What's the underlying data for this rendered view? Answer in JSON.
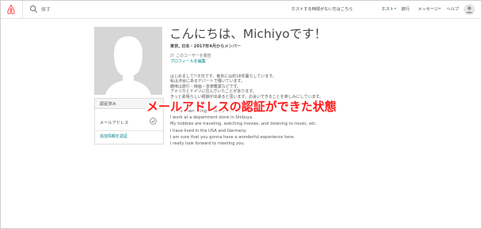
{
  "colors": {
    "brand": "#ff5a5f",
    "link": "#008489",
    "dot": "#00a699",
    "overlay": "#ff1a1a"
  },
  "header": {
    "logo_icon": "airbnb-logo-icon",
    "search_icon": "search-icon",
    "search_placeholder": "探す",
    "nav": {
      "host_label": "ホストする時間がない方はこちら",
      "host_short": "ホスト",
      "trips": "旅行",
      "messages": "メッセージ",
      "help": "ヘルプ",
      "avatar_icon": "user-avatar-icon"
    }
  },
  "sidebar": {
    "photo_icon": "profile-silhouette-icon",
    "verified_title": "認証済み",
    "email_label": "メールアドレス",
    "check_icon": "check-circle-icon",
    "add_verification": "追加情報を認証"
  },
  "main": {
    "greeting": "こんにちは、Michiyoです！",
    "meta": "東京, 日本・2017年4月からメンバー",
    "report": "このユーザーを報告",
    "edit_profile": "プロフィールを編集",
    "bio_jp": [
      "はじめまして!!子日です。東京には約18年暮らしています。",
      "私は渋谷にあるデパートで働いています。",
      "趣味は旅行・映画・音楽鑑賞などです。",
      "アメリカとドイツに住んでいたことがあります。",
      "きっと素晴らしい経験が出来ると思います。お会いできることを楽しみにしています。"
    ],
    "bio_en": [
      "I have been living in Tokyo for about 18 years.",
      "I work at a department store in Shibuya.",
      "My hobbies are traveling, watching movies, and listening to music, etc.",
      "I have lived in the USA and Germany.",
      "I am sure that you gonna have a wonderful experience here.",
      "I really look forward to meeting you."
    ]
  },
  "annotation": {
    "text": "メールアドレスの認証ができた状態"
  }
}
